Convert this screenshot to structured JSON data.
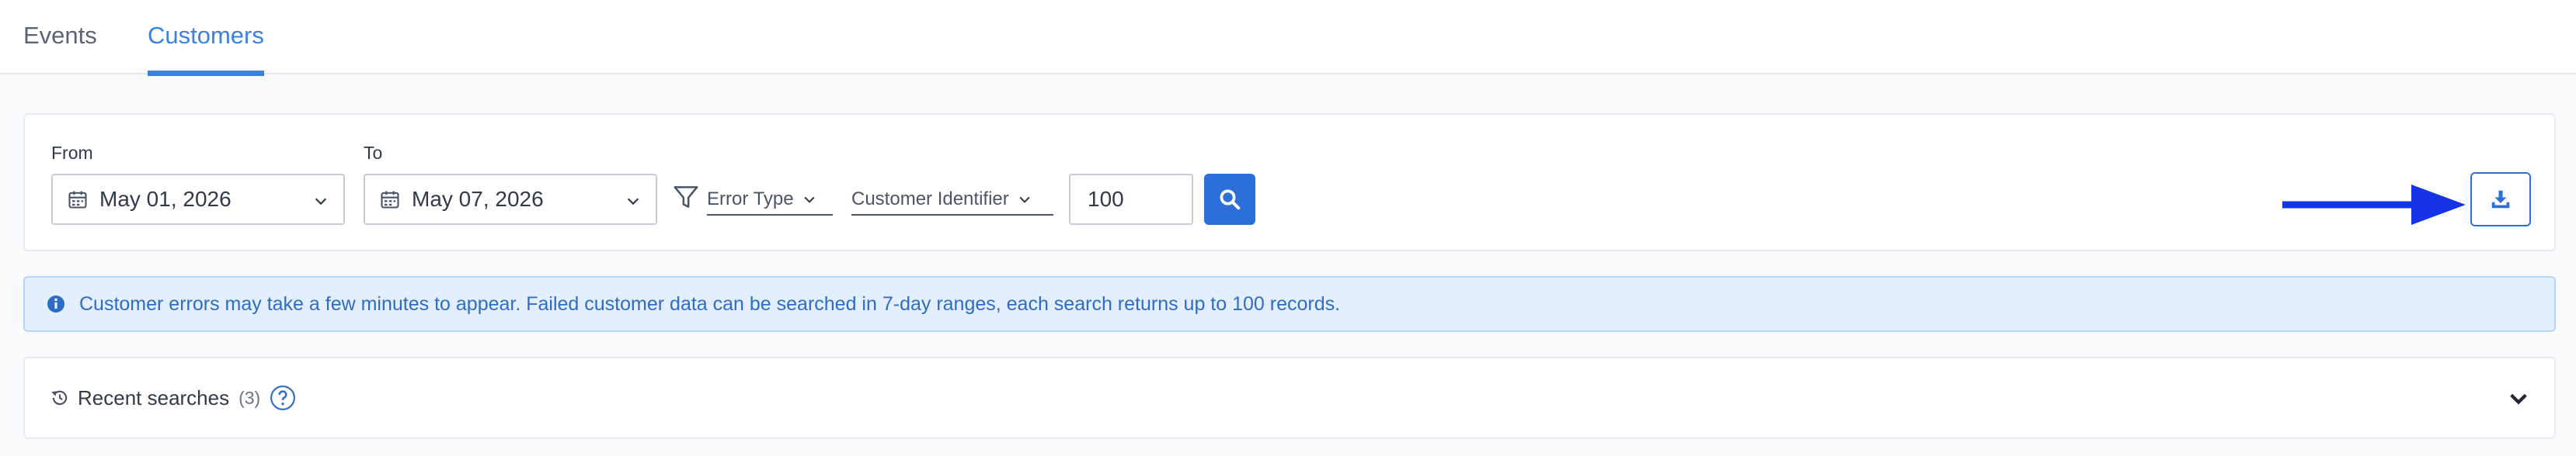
{
  "tabs": [
    {
      "label": "Events",
      "active": false
    },
    {
      "label": "Customers",
      "active": true
    }
  ],
  "filters": {
    "from_label": "From",
    "from_value": "May 01, 2026",
    "to_label": "To",
    "to_value": "May 07, 2026",
    "error_type_label": "Error Type",
    "customer_identifier_label": "Customer Identifier",
    "count_value": "100"
  },
  "info_banner": {
    "message": "Customer errors may take a few minutes to appear. Failed customer data can be searched in 7-day ranges, each search returns up to 100 records."
  },
  "recent_searches": {
    "title": "Recent searches",
    "count": "(3)"
  },
  "colors": {
    "accent": "#2d6fd8",
    "active_tab": "#3b82e0",
    "arrow": "#1434e6",
    "info_bg": "#e3efff",
    "info_text": "#2f6cc4"
  },
  "icons": [
    "calendar-icon",
    "chevron-down-icon",
    "filter-icon",
    "search-icon",
    "download-icon",
    "info-icon",
    "history-icon",
    "help-icon"
  ]
}
